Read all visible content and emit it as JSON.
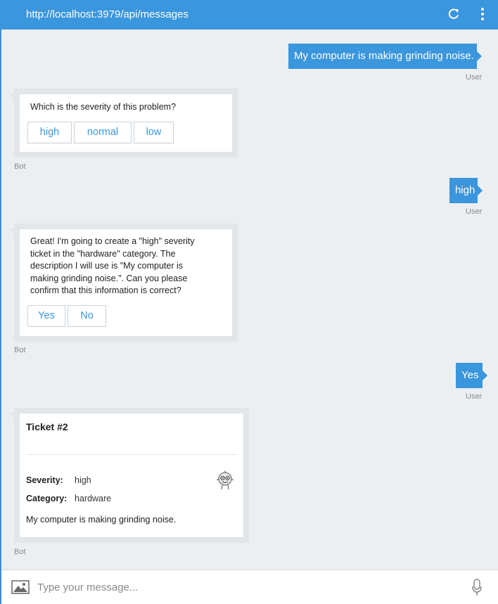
{
  "titlebar": {
    "url": "http://localhost:3979/api/messages",
    "refresh_icon": "refresh-icon",
    "menu_icon": "more-vertical-icon"
  },
  "messages": [
    {
      "from": "user",
      "text": "My computer is making grinding noise.",
      "sender": "User"
    },
    {
      "from": "bot",
      "sender": "Bot",
      "text": "Which is the severity of this problem?",
      "buttons": [
        "high",
        "normal",
        "low"
      ]
    },
    {
      "from": "user",
      "text": "high",
      "sender": "User"
    },
    {
      "from": "bot",
      "sender": "Bot",
      "lines": [
        "Great! I'm going to create a \"high\" severity",
        "ticket in the \"hardware\" category. The",
        "description I will use is \"My computer is",
        "making grinding noise.\". Can you please",
        "confirm that this information is correct?"
      ],
      "buttons": [
        "Yes",
        "No"
      ]
    },
    {
      "from": "user",
      "text": "Yes",
      "sender": "User"
    },
    {
      "from": "bot",
      "sender": "Bot",
      "ticket": {
        "title": "Ticket #2",
        "facts": [
          {
            "label": "Severity:",
            "value": "high"
          },
          {
            "label": "Category:",
            "value": "hardware"
          }
        ],
        "description": "My computer is making grinding noise.",
        "image_icon": "bot-avatar-icon"
      }
    }
  ],
  "input": {
    "placeholder": "Type your message...",
    "upload_icon": "image-upload-icon",
    "mic_icon": "microphone-icon"
  },
  "colors": {
    "accent": "#3a96dd",
    "background": "#eceff1"
  }
}
